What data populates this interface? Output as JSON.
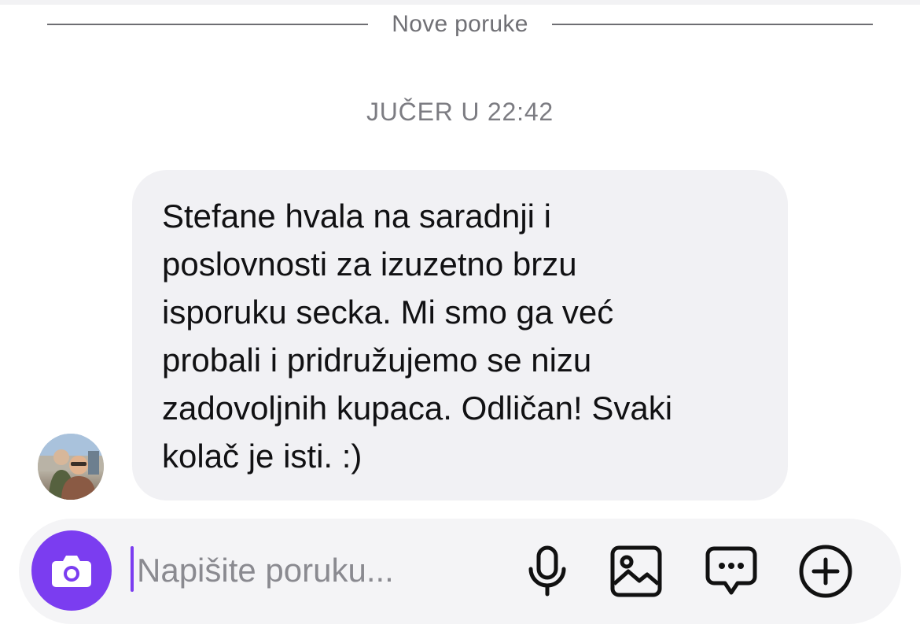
{
  "divider": {
    "label": "Nove poruke"
  },
  "conversation": {
    "timestamp": "JUČER U 22:42",
    "message": {
      "text": "Stefane hvala na saradnji i\nposlovnosti za izuzetno brzu\nisporuku secka. Mi smo ga već\nprobali i pridružujemo se nizu\nzadovoljnih kupaca. Odličan! Svaki\nkolač je isti. :)"
    }
  },
  "composer": {
    "placeholder": "Napišite poruku...",
    "value": "",
    "icons": [
      "camera-icon",
      "microphone-icon",
      "image-icon",
      "chat-bubble-icon",
      "plus-circle-icon"
    ]
  },
  "colors": {
    "accent": "#7b3df0",
    "bubble": "#f1f1f4",
    "composer": "#f4f4f6",
    "muted_text": "#7c7c82"
  }
}
